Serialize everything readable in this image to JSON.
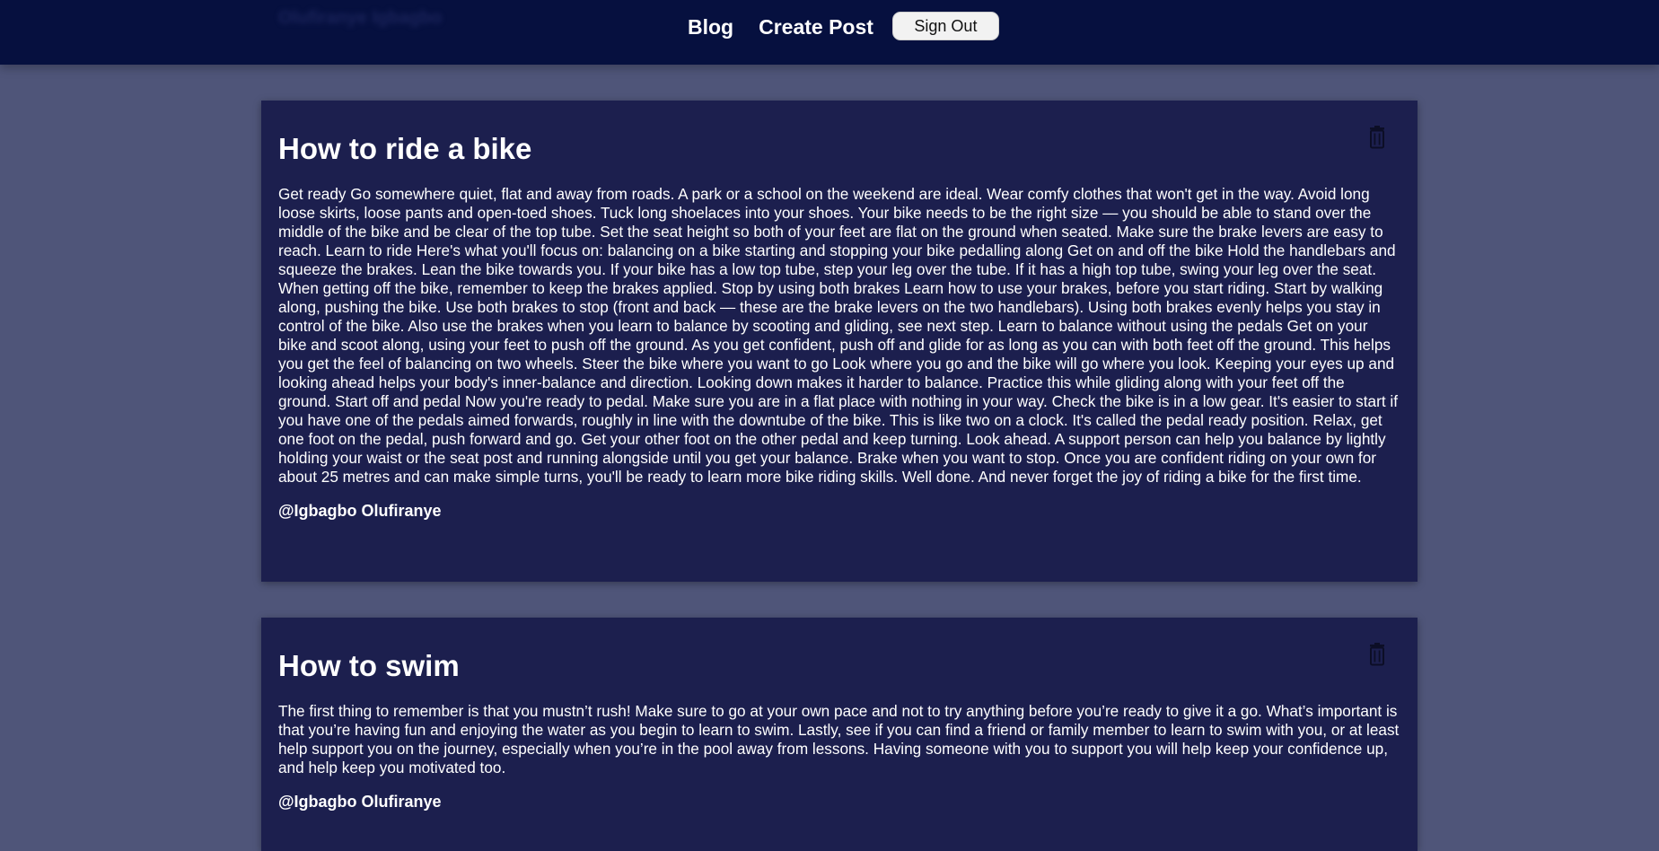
{
  "navbar": {
    "ghost_text": "Olufiranye Igbagbo",
    "links": [
      "Blog",
      "Create Post"
    ],
    "sign_out_label": "Sign Out"
  },
  "posts": [
    {
      "title": "How to ride a bike",
      "body": "Get ready Go somewhere quiet, flat and away from roads. A park or a school on the weekend are ideal. Wear comfy clothes that won't get in the way. Avoid long loose skirts, loose pants and open-toed shoes. Tuck long shoelaces into your shoes. Your bike needs to be the right size — you should be able to stand over the middle of the bike and be clear of the top tube. Set the seat height so both of your feet are flat on the ground when seated. Make sure the brake levers are easy to reach. Learn to ride Here's what you'll focus on: balancing on a bike starting and stopping your bike pedalling along Get on and off the bike Hold the handlebars and squeeze the brakes. Lean the bike towards you. If your bike has a low top tube, step your leg over the tube. If it has a high top tube, swing your leg over the seat. When getting off the bike, remember to keep the brakes applied. Stop by using both brakes Learn how to use your brakes, before you start riding. Start by walking along, pushing the bike. Use both brakes to stop (front and back — these are the brake levers on the two handlebars). Using both brakes evenly helps you stay in control of the bike. Also use the brakes when you learn to balance by scooting and gliding, see next step. Learn to balance without using the pedals Get on your bike and scoot along, using your feet to push off the ground. As you get confident, push off and glide for as long as you can with both feet off the ground. This helps you get the feel of balancing on two wheels. Steer the bike where you want to go Look where you go and the bike will go where you look. Keeping your eyes up and looking ahead helps your body's inner-balance and direction. Looking down makes it harder to balance. Practice this while gliding along with your feet off the ground. Start off and pedal Now you're ready to pedal. Make sure you are in a flat place with nothing in your way. Check the bike is in a low gear. It's easier to start if you have one of the pedals aimed forwards, roughly in line with the downtube of the bike. This is like two on a clock. It's called the pedal ready position. Relax, get one foot on the pedal, push forward and go. Get your other foot on the other pedal and keep turning. Look ahead. A support person can help you balance by lightly holding your waist or the seat post and running alongside until you get your balance. Brake when you want to stop. Once you are confident riding on your own for about 25 metres and can make simple turns, you'll be ready to learn more bike riding skills. Well done. And never forget the joy of riding a bike for the first time.",
      "author": "@Igbagbo Olufiranye",
      "delete_icon": "trash-icon"
    },
    {
      "title": "How to swim",
      "body": "The first thing to remember is that you mustn’t rush! Make sure to go at your own pace and not to try anything before you’re ready to give it a go. What’s important is that you’re having fun and enjoying the water as you begin to learn to swim. Lastly, see if you can find a friend or family member to learn to swim with you, or at least help support you on the journey, especially when you’re in the pool away from lessons. Having someone with you to support you will help keep your confidence up, and help keep you motivated too.",
      "author": "@Igbagbo Olufiranye",
      "delete_icon": "trash-icon"
    }
  ],
  "colors": {
    "page_background": "#4f5579",
    "navbar_background": "#06103f",
    "card_background": "#1c1f4e",
    "text": "#ffffff",
    "button_background": "#f2f2f2",
    "icon": "#0c0e26"
  }
}
